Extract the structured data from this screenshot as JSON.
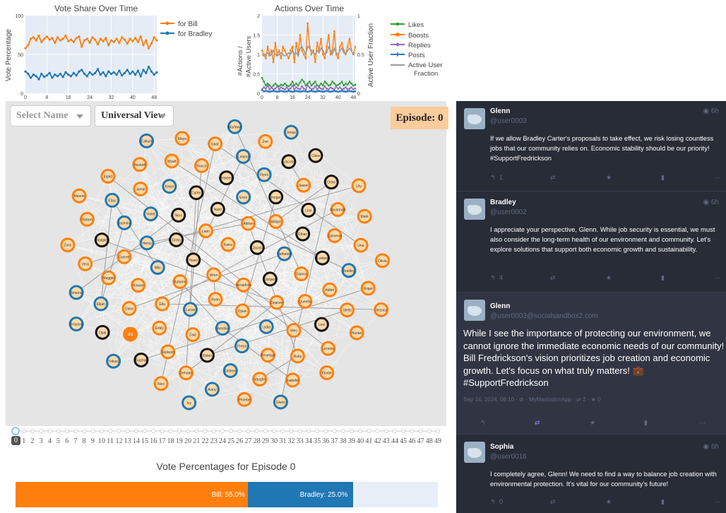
{
  "vote_chart": {
    "title": "Vote Share Over Time",
    "ylabel": "Vote Percentage",
    "y_ticks": [
      "100",
      "50",
      "0"
    ],
    "x_ticks": [
      "0",
      "8",
      "16",
      "24",
      "32",
      "40",
      "48"
    ],
    "legend": [
      "for Bill",
      "for Bradley"
    ],
    "colors": {
      "bill": "#ff7f0e",
      "bradley": "#1f77b4",
      "bg": "#e5ecf6"
    }
  },
  "actions_chart": {
    "title": "Actions Over Time",
    "ylabel_left": "#Actions / #Active Users",
    "ylabel_right": "Active User Fraction",
    "y_ticks_left": [
      "2",
      "1.5",
      "1",
      "0.5",
      "0"
    ],
    "y_ticks_right": [
      "1",
      "0.5",
      "0"
    ],
    "x_ticks": [
      "0",
      "8",
      "16",
      "24",
      "32",
      "40",
      "48"
    ],
    "legend": [
      "Likes",
      "Boosts",
      "Replies",
      "Posts",
      "Active User",
      "Fraction"
    ],
    "colors": {
      "likes": "#2ca02c",
      "boosts": "#ff7f0e",
      "replies": "#9467bd",
      "posts": "#1f77b4",
      "active": "#999999"
    }
  },
  "chart_data": [
    {
      "type": "line",
      "title": "Vote Share Over Time",
      "xlabel": "",
      "ylabel": "Vote Percentage",
      "ylim": [
        0,
        100
      ],
      "xlim": [
        0,
        49
      ],
      "series": [
        {
          "name": "for Bill",
          "values": [
            58,
            62,
            70,
            72,
            68,
            74,
            66,
            70,
            73,
            69,
            71,
            65,
            72,
            68,
            70,
            74,
            67,
            69,
            66,
            71,
            73,
            60,
            68,
            70,
            65,
            72,
            69,
            63,
            70,
            67,
            71,
            62,
            68,
            66,
            70,
            65,
            72,
            69,
            64,
            70,
            67,
            71,
            66,
            73,
            62,
            68,
            58,
            64,
            72,
            68
          ]
        },
        {
          "name": "for Bradley",
          "values": [
            28,
            25,
            20,
            24,
            22,
            18,
            25,
            21,
            23,
            26,
            20,
            24,
            22,
            25,
            21,
            27,
            24,
            22,
            26,
            23,
            28,
            30,
            25,
            22,
            27,
            24,
            26,
            31,
            24,
            27,
            22,
            28,
            25,
            27,
            24,
            29,
            23,
            26,
            30,
            25,
            28,
            24,
            29,
            22,
            30,
            26,
            34,
            28,
            24,
            27
          ]
        }
      ]
    },
    {
      "type": "line",
      "title": "Actions Over Time",
      "xlabel": "",
      "ylabel": "#Actions / #Active Users",
      "ylim": [
        0,
        2
      ],
      "xlim": [
        0,
        49
      ],
      "series": [
        {
          "name": "Boosts",
          "values": [
            1.1,
            1.0,
            0.9,
            1.2,
            1.0,
            1.1,
            0.8,
            1.3,
            1.0,
            1.1,
            0.9,
            1.2,
            1.1,
            1.0,
            0.9,
            1.1,
            1.2,
            0.8,
            1.3,
            1.0,
            1.5,
            1.1,
            1.0,
            0.9,
            1.8,
            1.2,
            1.0,
            1.1,
            0.8,
            1.3,
            1.1,
            1.4,
            1.0,
            0.9,
            1.2,
            1.5,
            1.0,
            1.1,
            1.6,
            1.0,
            0.9,
            1.2,
            1.3,
            1.1,
            1.0,
            1.2,
            1.4,
            1.1,
            1.0,
            1.2
          ]
        },
        {
          "name": "Likes",
          "values": [
            0.4,
            0.3,
            0.2,
            0.25,
            0.2,
            0.15,
            0.2,
            0.25,
            0.2,
            0.18,
            0.22,
            0.2,
            0.25,
            0.2,
            0.18,
            0.22,
            0.3,
            0.2,
            0.25,
            0.2,
            0.28,
            0.35,
            0.3,
            0.2,
            0.25,
            0.3,
            0.2,
            0.25,
            0.3,
            0.2,
            0.18,
            0.25,
            0.2,
            0.3,
            0.25,
            0.2,
            0.22,
            0.3,
            0.25,
            0.2,
            0.22,
            0.25,
            0.3,
            0.2,
            0.25,
            0.22,
            0.3,
            0.25,
            0.2,
            0.22
          ]
        },
        {
          "name": "Replies",
          "values": [
            0.1,
            0.15,
            0.12,
            0.2,
            0.1,
            0.15,
            0.1,
            0.12,
            0.18,
            0.1,
            0.15,
            0.12,
            0.1,
            0.15,
            0.1,
            0.12,
            0.2,
            0.1,
            0.15,
            0.12,
            0.1,
            0.18,
            0.12,
            0.1,
            0.2,
            0.15,
            0.1,
            0.12,
            0.18,
            0.1,
            0.15,
            0.12,
            0.1,
            0.18,
            0.12,
            0.1,
            0.15,
            0.12,
            0.1,
            0.18,
            0.12,
            0.15,
            0.1,
            0.12,
            0.15,
            0.1,
            0.12,
            0.15,
            0.1,
            0.12
          ]
        },
        {
          "name": "Posts",
          "values": [
            0.08,
            0.05,
            0.06,
            0.05,
            0.04,
            0.05,
            0.06,
            0.05,
            0.04,
            0.05,
            0.06,
            0.05,
            0.04,
            0.05,
            0.06,
            0.05,
            0.04,
            0.05,
            0.06,
            0.05,
            0.04,
            0.05,
            0.06,
            0.05,
            0.04,
            0.05,
            0.06,
            0.05,
            0.04,
            0.05,
            0.06,
            0.05,
            0.04,
            0.05,
            0.06,
            0.05,
            0.04,
            0.05,
            0.06,
            0.05,
            0.04,
            0.05,
            0.06,
            0.05,
            0.04,
            0.05,
            0.06,
            0.05,
            0.04,
            0.05
          ]
        },
        {
          "name": "Active User Fraction",
          "values": [
            0.5,
            0.48,
            0.5,
            0.52,
            0.48,
            0.5,
            0.55,
            0.5,
            0.48,
            0.5,
            0.52,
            0.5,
            0.48,
            0.5,
            0.52,
            0.5,
            0.55,
            0.5,
            0.52,
            0.48,
            0.58,
            0.6,
            0.55,
            0.5,
            0.6,
            0.58,
            0.55,
            0.52,
            0.5,
            0.55,
            0.52,
            0.58,
            0.55,
            0.5,
            0.52,
            0.6,
            0.55,
            0.5,
            0.58,
            0.52,
            0.5,
            0.55,
            0.58,
            0.52,
            0.5,
            0.55,
            0.58,
            0.55,
            0.5,
            0.52
          ]
        }
      ]
    },
    {
      "type": "bar",
      "title": "Vote Percentages for Episode 0",
      "categories": [
        "Bill",
        "Bradley"
      ],
      "values": [
        55.0,
        25.0
      ],
      "ylim": [
        0,
        100
      ]
    }
  ],
  "controls": {
    "select_name": "Select Name",
    "view": "Universal View",
    "episode": "Episode: 0"
  },
  "network": {
    "nodes": [
      {
        "name": "Wren",
        "ring": "orange"
      },
      {
        "name": "Keira",
        "ring": "orange"
      },
      {
        "name": "Seraphina",
        "ring": "orange"
      },
      {
        "name": "Hazel",
        "ring": "black"
      },
      {
        "name": "Jacob",
        "ring": "black"
      },
      {
        "name": "Ryan",
        "ring": "orange"
      },
      {
        "name": "Liam",
        "ring": "orange"
      },
      {
        "name": "Jasper",
        "ring": "black"
      },
      {
        "name": "Autumn",
        "ring": "orange"
      },
      {
        "name": "Adrian",
        "ring": "orange"
      },
      {
        "name": "Dylan",
        "ring": "orange"
      },
      {
        "name": "Greta",
        "ring": "black"
      },
      {
        "name": "Nathaniel",
        "ring": "blue"
      },
      {
        "name": "Lucas",
        "ring": "blue"
      },
      {
        "name": "Nash",
        "ring": "black"
      },
      {
        "name": "Deacon",
        "ring": "orange"
      },
      {
        "name": "Milo",
        "ring": "blue"
      },
      {
        "name": "William",
        "ring": "orange"
      },
      {
        "name": "Amelia",
        "ring": "blue"
      },
      {
        "name": "Nina",
        "ring": "black"
      },
      {
        "name": "Gianna",
        "ring": "orange"
      },
      {
        "name": "Ella",
        "ring": "orange"
      },
      {
        "name": "Enzo",
        "ring": "blue"
      },
      {
        "name": "Lydia",
        "ring": "blue"
      },
      {
        "name": "Henry",
        "ring": "blue"
      },
      {
        "name": "Ethan",
        "ring": "black"
      },
      {
        "name": "Zaid",
        "ring": "orange"
      },
      {
        "name": "Carter",
        "ring": "black"
      },
      {
        "name": "Quentin",
        "ring": "orange"
      },
      {
        "name": "Rowan",
        "ring": "orange"
      },
      {
        "name": "Imogen",
        "ring": "black"
      },
      {
        "name": "Freya",
        "ring": "blue"
      },
      {
        "name": "Violet",
        "ring": "blue"
      },
      {
        "name": "Leilani",
        "ring": "black"
      },
      {
        "name": "Emily",
        "ring": "orange"
      },
      {
        "name": "Harper",
        "ring": "black"
      },
      {
        "name": "Wes",
        "ring": "orange"
      },
      {
        "name": "Garrett",
        "ring": "orange"
      },
      {
        "name": "Linn",
        "ring": "black"
      },
      {
        "name": "Robin",
        "ring": "black"
      },
      {
        "name": "Kaiya",
        "ring": "blue"
      },
      {
        "name": "Aiden",
        "ring": "orange"
      },
      {
        "name": "Dana",
        "ring": "orange"
      },
      {
        "name": "Flynn",
        "ring": "blue"
      },
      {
        "name": "Penelope",
        "ring": "orange"
      },
      {
        "name": "Jasmine",
        "ring": "blue"
      },
      {
        "name": "Cameron",
        "ring": "orange"
      },
      {
        "name": "Jackson",
        "ring": "orange"
      },
      {
        "name": "Rocco",
        "ring": "orange"
      },
      {
        "name": "Levi",
        "ring": "black"
      },
      {
        "name": "Maggie",
        "ring": "orange"
      },
      {
        "name": "Jasper B",
        "ring": "orange"
      },
      {
        "name": "Gideon",
        "ring": "blue"
      },
      {
        "name": "Jamal",
        "ring": "orange"
      },
      {
        "name": "Bradley",
        "ring": "blue"
      },
      {
        "name": "Bill",
        "ring": "orange"
      },
      {
        "name": "Leland",
        "ring": "blue"
      },
      {
        "name": "Ruby",
        "ring": "orange"
      },
      {
        "name": "Natalie",
        "ring": "black"
      },
      {
        "name": "Savannah",
        "ring": "orange"
      },
      {
        "name": "Dehaan",
        "ring": "orange"
      },
      {
        "name": "Wyatt",
        "ring": "orange"
      },
      {
        "name": "Stella",
        "ring": "orange"
      },
      {
        "name": "Elijah",
        "ring": "blue"
      },
      {
        "name": "Jacob S",
        "ring": "black"
      },
      {
        "name": "Vaughn",
        "ring": "orange"
      },
      {
        "name": "Elias",
        "ring": "blue"
      },
      {
        "name": "Una",
        "ring": "orange"
      },
      {
        "name": "Sophia",
        "ring": "black"
      },
      {
        "name": "Isaac",
        "ring": "orange"
      },
      {
        "name": "Lennox",
        "ring": "orange"
      },
      {
        "name": "Vera",
        "ring": "orange"
      },
      {
        "name": "Orion",
        "ring": "black"
      },
      {
        "name": "Avery",
        "ring": "blue"
      },
      {
        "name": "Beckett",
        "ring": "orange"
      },
      {
        "name": "Roger",
        "ring": "orange"
      },
      {
        "name": "Opal",
        "ring": "black"
      },
      {
        "name": "Zoe",
        "ring": "orange"
      },
      {
        "name": "Isabelle",
        "ring": "orange"
      },
      {
        "name": "Robert",
        "ring": "orange"
      },
      {
        "name": "Mark",
        "ring": "orange"
      },
      {
        "name": "Nico",
        "ring": "orange"
      },
      {
        "name": "Maya",
        "ring": "orange"
      },
      {
        "name": "Hunter",
        "ring": "orange"
      },
      {
        "name": "Simone",
        "ring": "blue"
      },
      {
        "name": "Clara",
        "ring": "black"
      },
      {
        "name": "Phoebe",
        "ring": "orange"
      },
      {
        "name": "Ingrid",
        "ring": "orange"
      },
      {
        "name": "Olivia",
        "ring": "orange"
      },
      {
        "name": "Tobias",
        "ring": "blue"
      },
      {
        "name": "Marlowe",
        "ring": "blue"
      },
      {
        "name": "Elodie",
        "ring": "orange"
      },
      {
        "name": "Zora",
        "ring": "orange"
      },
      {
        "name": "Lily",
        "ring": "orange"
      },
      {
        "name": "Ivy",
        "ring": "blue"
      },
      {
        "name": "Callum",
        "ring": "blue"
      },
      {
        "name": "Jessica",
        "ring": "orange"
      },
      {
        "name": "Grayson",
        "ring": "blue"
      },
      {
        "name": "Jonas",
        "ring": "blue"
      },
      {
        "name": "Glenn",
        "ring": "blue"
      },
      {
        "name": "Mason",
        "ring": "orange"
      }
    ]
  },
  "slider": {
    "ticks": [
      "0",
      "1",
      "2",
      "3",
      "4",
      "5",
      "6",
      "7",
      "8",
      "9",
      "10",
      "11",
      "12",
      "13",
      "14",
      "15",
      "16",
      "17",
      "18",
      "19",
      "20",
      "21",
      "22",
      "23",
      "24",
      "25",
      "26",
      "27",
      "28",
      "29",
      "30",
      "31",
      "32",
      "33",
      "34",
      "35",
      "36",
      "37",
      "38",
      "39",
      "40",
      "41",
      "42",
      "43",
      "44",
      "45",
      "46",
      "47",
      "48",
      "49"
    ],
    "value": 0
  },
  "vote_bars": {
    "title": "Vote Percentages for Episode 0",
    "bill_label": "Bill: 55.0%",
    "bradley_label": "Bradley: 25.0%"
  },
  "feed": {
    "posts": [
      {
        "display_name": "Glenn",
        "username": "@user0003",
        "time": "6h",
        "text": "If we allow Bradley Carter's proposals to take effect, we risk losing countless jobs that our community relies on. Economic stability should be our priority! #SupportFredrickson",
        "replies": "1"
      },
      {
        "display_name": "Bradley",
        "username": "@user0002",
        "time": "6h",
        "text": "I appreciate your perspective, Glenn. While job security is essential, we must also consider the long-term health of our environment and community. Let's explore solutions that support both economic growth and sustainability.",
        "replies": "4"
      },
      {
        "display_name": "Glenn",
        "username": "@user0003@socialsandbox2.com",
        "text": "While I see the importance of protecting our environment, we cannot ignore the immediate economic needs of our community! Bill Fredrickson's vision prioritizes job creation and economic growth. Let's focus on what truly matters! 💼 #SupportFredrickson",
        "meta": "Sep 14, 2024, 06:10 · ⊘ · MyMastodonApp · ⇄ 2 · ★ 0"
      },
      {
        "display_name": "Sophia",
        "username": "@user0016",
        "time": "6h",
        "text": "I completely agree, Glenn! We need to find a way to balance job creation with environmental protection. It's vital for our community's future!",
        "replies": "0"
      }
    ]
  }
}
